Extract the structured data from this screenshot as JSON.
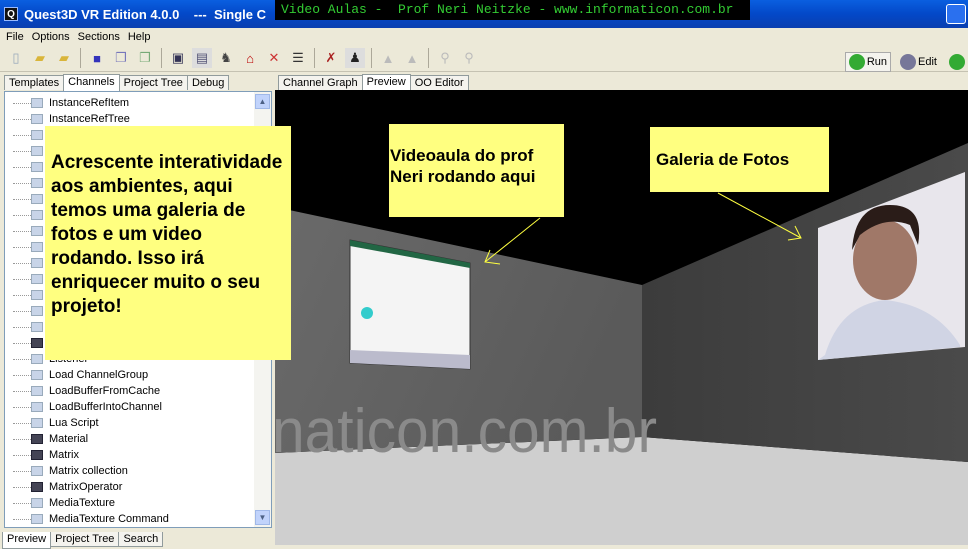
{
  "window": {
    "title": "Quest3D VR Edition 4.0.0    ---  Single C",
    "banner": "Video Aulas -  Prof Neri Neitzke - www.informaticon.com.br"
  },
  "menu": [
    "File",
    "Options",
    "Sections",
    "Help"
  ],
  "toolbar": {
    "run_label": "Run",
    "edit_label": "Edit"
  },
  "left_tabs": [
    "Templates",
    "Channels",
    "Project Tree",
    "Debug"
  ],
  "left_active": "Channels",
  "tree_items": [
    {
      "label": "InstanceRefItem",
      "dark": false
    },
    {
      "label": "InstanceRefTree",
      "dark": false
    },
    {
      "label": "",
      "dark": false
    },
    {
      "label": "",
      "dark": false
    },
    {
      "label": "",
      "dark": false
    },
    {
      "label": "",
      "dark": false
    },
    {
      "label": "",
      "dark": false
    },
    {
      "label": "",
      "dark": false
    },
    {
      "label": "",
      "dark": false
    },
    {
      "label": "",
      "dark": false
    },
    {
      "label": "",
      "dark": false
    },
    {
      "label": "",
      "dark": false
    },
    {
      "label": "",
      "dark": false
    },
    {
      "label": "",
      "dark": false
    },
    {
      "label": "",
      "dark": false
    },
    {
      "label": "",
      "dark": true
    },
    {
      "label": "Listener",
      "dark": false
    },
    {
      "label": "Load ChannelGroup",
      "dark": false
    },
    {
      "label": "LoadBufferFromCache",
      "dark": false
    },
    {
      "label": "LoadBufferIntoChannel",
      "dark": false
    },
    {
      "label": "Lua Script",
      "dark": false
    },
    {
      "label": "Material",
      "dark": true
    },
    {
      "label": "Matrix",
      "dark": true
    },
    {
      "label": "Matrix collection",
      "dark": false
    },
    {
      "label": "MatrixOperator",
      "dark": true
    },
    {
      "label": "MediaTexture",
      "dark": false
    },
    {
      "label": "MediaTexture Command",
      "dark": false
    }
  ],
  "bottom_tabs": [
    "Preview",
    "Project Tree",
    "Search"
  ],
  "main_tabs": [
    "Channel Graph",
    "Preview",
    "OO Editor"
  ],
  "main_active": "Preview",
  "notes": {
    "main": "Acrescente interatividade  aos ambientes, aqui temos uma galeria de fotos e um video rodando. Isso irá enriquecer muito o seu projeto!",
    "video": "Videoaula do prof Neri rodando aqui",
    "gallery": "Galeria de Fotos"
  },
  "scene": {
    "wall_text": "naticon.com.br"
  },
  "colors": {
    "note": "#ffff80",
    "titlebar": "#0348c8",
    "banner_text": "#33cc33"
  }
}
